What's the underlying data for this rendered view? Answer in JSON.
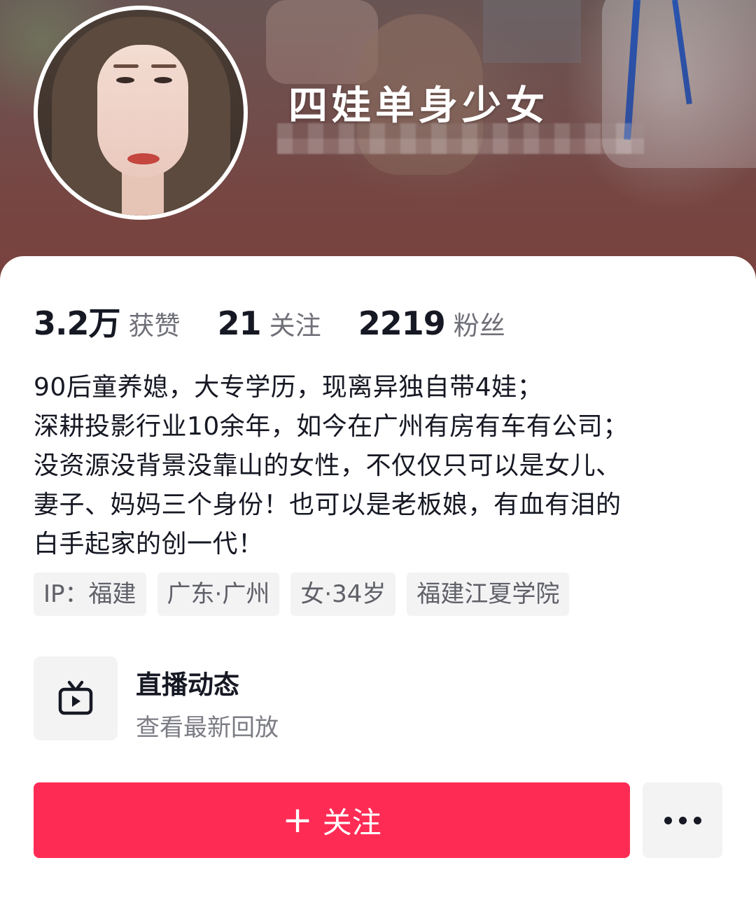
{
  "profile": {
    "nickname": "四娃单身少女"
  },
  "stats": [
    {
      "value": "3.2万",
      "label": "获赞"
    },
    {
      "value": "21",
      "label": "关注"
    },
    {
      "value": "2219",
      "label": "粉丝"
    }
  ],
  "bio": [
    "90后童养媳，大专学历，现离异独自带4娃；",
    "深耕投影行业10余年，如今在广州有房有车有公司；",
    "没资源没背景没靠山的女性，不仅仅只可以是女儿、",
    "妻子、妈妈三个身份！也可以是老板娘，有血有泪的",
    "白手起家的创一代！"
  ],
  "tags": [
    "IP：福建",
    "广东·广州",
    "女·34岁",
    "福建江夏学院"
  ],
  "live": {
    "title": "直播动态",
    "subtitle": "查看最新回放",
    "icon": "tv-icon"
  },
  "actions": {
    "follow_plus": "+",
    "follow_label": "关注",
    "more_icon": "more-dots-icon"
  },
  "colors": {
    "accent": "#fe2c55",
    "tag_bg": "#f3f3f4",
    "banner": "#83504c"
  }
}
